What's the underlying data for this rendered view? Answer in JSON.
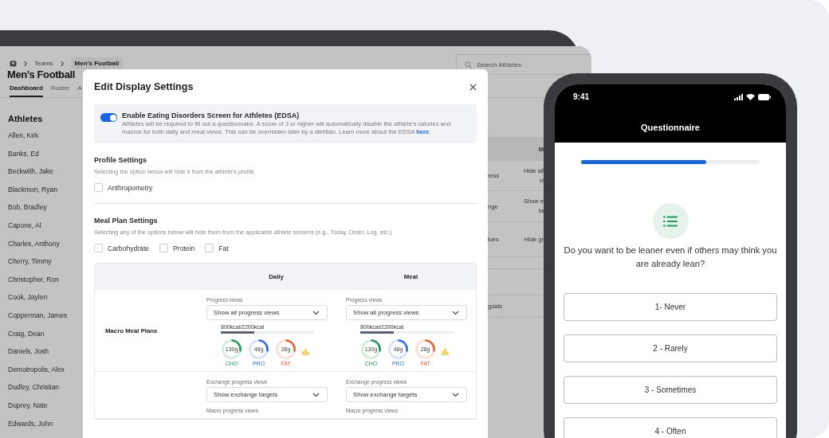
{
  "tablet": {
    "breadcrumb": [
      "Teams",
      "Men’s Football"
    ],
    "title": "Men’s Football",
    "tabs": [
      {
        "label": "Dashboard",
        "selected": true
      },
      {
        "label": "Roster",
        "selected": false
      },
      {
        "label": "A",
        "selected": false
      }
    ],
    "search": {
      "placeholder": "Search Athletes"
    },
    "athletes_heading": "Athletes",
    "athletes": [
      "Allen, Kirk",
      "Banks, Ed",
      "Beckwith, Jake",
      "Blackmon, Ryan",
      "Bob, Bradley",
      "Capone, Al",
      "Charles, Anthony",
      "Cherry, Timmy",
      "Christopher, Ron",
      "Cook, Jaylen",
      "Copperman, James",
      "Craig, Dean",
      "Daniels, Josh",
      "Demotropolis, Alex",
      "Dudley, Christian",
      "Duprey, Nate",
      "Edwards, John"
    ],
    "table_fragment": {
      "header": "M",
      "rows": [
        {
          "column_1": "ress",
          "column_2": [
            "Hide all",
            "vi"
          ]
        },
        {
          "column_1": "nge",
          "column_2": [
            "Show e",
            "ta"
          ]
        },
        {
          "column_1": "lues",
          "column_2": [
            "Hide gr"
          ]
        },
        {
          "column_1": "goals"
        }
      ]
    }
  },
  "modal": {
    "title": "Edit Display Settings",
    "edsa": {
      "on": true,
      "title": "Enable Eating Disorders Screen for Athletes (EDSA)",
      "description": "Athletes will be required to fill out a questionnaire. A score of 3 or higher will automatically disable the athlete’s calories and macros for both daily and meal views. This can be overridden later by a dietitian. Learn more about the EDSA ",
      "link": "here",
      "description_end": "."
    },
    "profile": {
      "heading": "Profile Settings",
      "note": "Selecting the option below will hide it from the athlete’s profile",
      "options": [
        {
          "label": "Anthropometry",
          "checked": false
        }
      ]
    },
    "meal_plan": {
      "heading": "Meal Plan Settings",
      "note": "Selecting any of the options below will hide them from the applicable athlete screens (e.g., Today, Order, Log, etc.)",
      "options": [
        {
          "label": "Carbohydrate",
          "checked": false
        },
        {
          "label": "Protein",
          "checked": false
        },
        {
          "label": "Fat",
          "checked": false
        }
      ]
    },
    "table": {
      "columns": [
        "Daily",
        "Meal"
      ],
      "rows": [
        {
          "label": "Macro Meal Plans",
          "cells": [
            {
              "fields": [
                {
                  "label": "Progress views",
                  "value": "Show all progress views"
                }
              ],
              "preview": {
                "calories": "800kcal/2200kcal",
                "level": 0.36,
                "rings": [
                  {
                    "value": "130g",
                    "name": "CHO",
                    "color": "#1e9b57"
                  },
                  {
                    "value": "48g",
                    "name": "PRO",
                    "color": "#2f6fe8"
                  },
                  {
                    "value": "28g",
                    "name": "FAT",
                    "color": "#e8602c"
                  }
                ]
              }
            },
            {
              "fields": [
                {
                  "label": "Progress views",
                  "value": "Show all progress views"
                }
              ],
              "preview": {
                "calories": "800kcal/2200kcal",
                "level": 0.36,
                "rings": [
                  {
                    "value": "130g",
                    "name": "CHO",
                    "color": "#1e9b57"
                  },
                  {
                    "value": "48g",
                    "name": "PRO",
                    "color": "#2f6fe8"
                  },
                  {
                    "value": "28g",
                    "name": "FAT",
                    "color": "#e8602c"
                  }
                ]
              }
            }
          ]
        },
        {
          "cells": [
            {
              "fields": [
                {
                  "label": "Exchange progress views",
                  "value": "Show exchange targets"
                },
                {
                  "label": "Macro progress views"
                }
              ]
            },
            {
              "fields": [
                {
                  "label": "Exchange progress views",
                  "value": "Show exchange targets"
                },
                {
                  "label": "Macro progress views"
                }
              ]
            }
          ]
        }
      ]
    }
  },
  "phone": {
    "time": "9:41",
    "title": "Questionnaire",
    "progress": {
      "level": 0.7
    },
    "question": "Do you want to be leaner even if others may think you are already lean?",
    "options": [
      "1- Never",
      "2 - Rarely",
      "3 - Sometimes",
      "4 - Often"
    ]
  }
}
